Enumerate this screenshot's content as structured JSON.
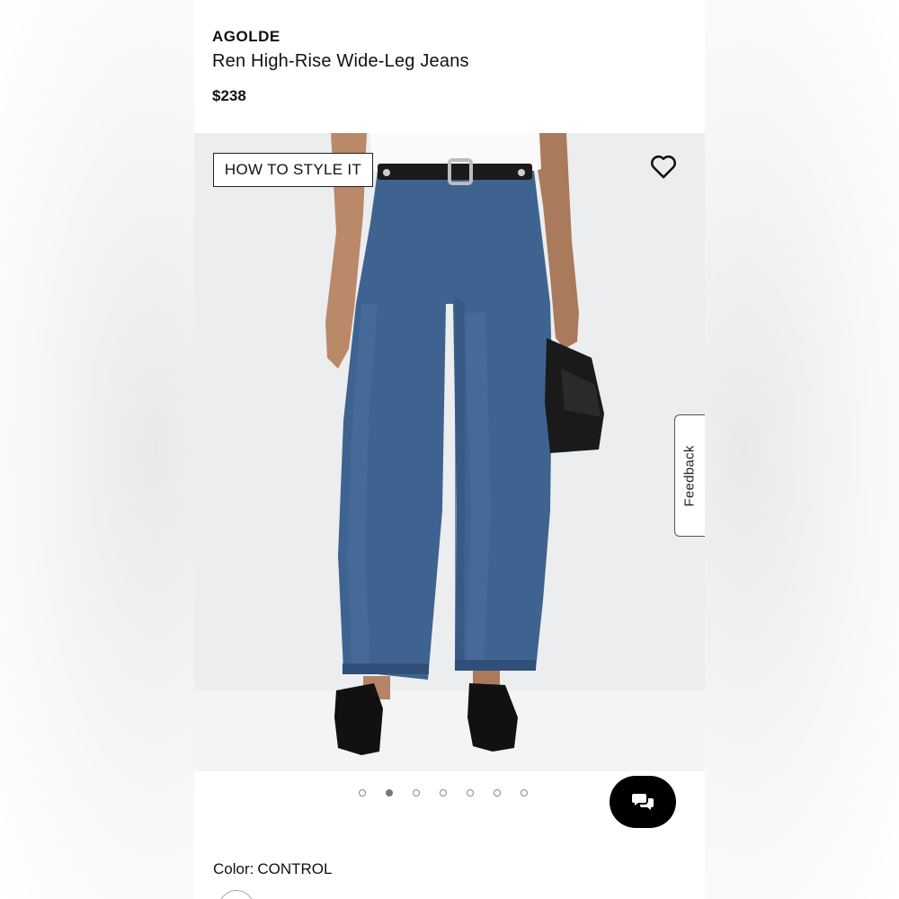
{
  "product": {
    "brand": "AGOLDE",
    "name": "Ren High-Rise Wide-Leg Jeans",
    "price": "$238"
  },
  "gallery": {
    "style_button_label": "HOW TO STYLE IT",
    "favorite_icon": "heart-outline-icon",
    "image_subject": "model wearing medium-wash wide-leg jeans, white tee, black belt, black bag and black loafers",
    "dots_total": 7,
    "active_dot_index": 1
  },
  "feedback": {
    "label": "Feedback"
  },
  "chat": {
    "icon": "chat-bubbles-icon"
  },
  "color": {
    "label": "Color:",
    "value": "CONTROL"
  },
  "colors": {
    "denim": "#3f6390",
    "background": "#ecedef",
    "text": "#111111"
  }
}
